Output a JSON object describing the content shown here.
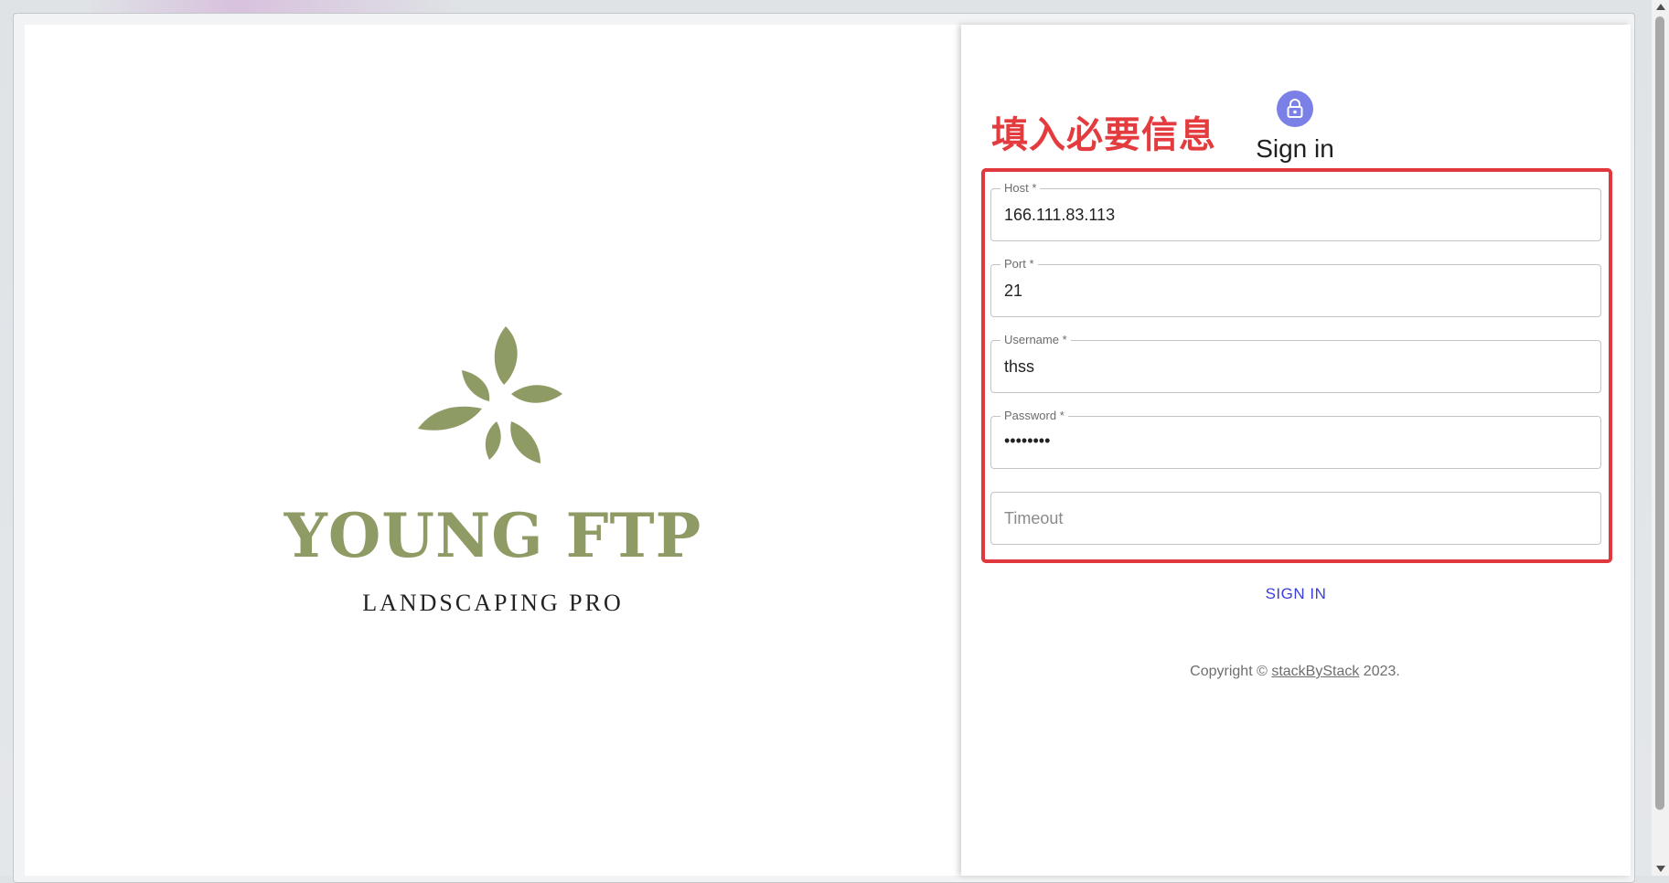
{
  "branding": {
    "name": "YOUNG FTP",
    "tagline": "LANDSCAPING PRO",
    "logo_icon": "leaf-flower-icon",
    "logo_color": "#8f9b64"
  },
  "annotation": {
    "text": "填入必要信息",
    "color": "#e0383d"
  },
  "signin": {
    "title": "Sign in",
    "avatar_icon": "lock-icon",
    "avatar_color": "#7a80e6",
    "button_label": "SIGN IN",
    "button_color": "#3a3fdc"
  },
  "fields": {
    "host": {
      "label": "Host *",
      "value": "166.111.83.113"
    },
    "port": {
      "label": "Port *",
      "value": "21"
    },
    "username": {
      "label": "Username *",
      "value": "thss"
    },
    "password": {
      "label": "Password *",
      "value": "••••••••"
    },
    "timeout": {
      "placeholder": "Timeout",
      "value": ""
    }
  },
  "footer": {
    "prefix": "Copyright © ",
    "link": "stackByStack",
    "suffix": " 2023."
  }
}
